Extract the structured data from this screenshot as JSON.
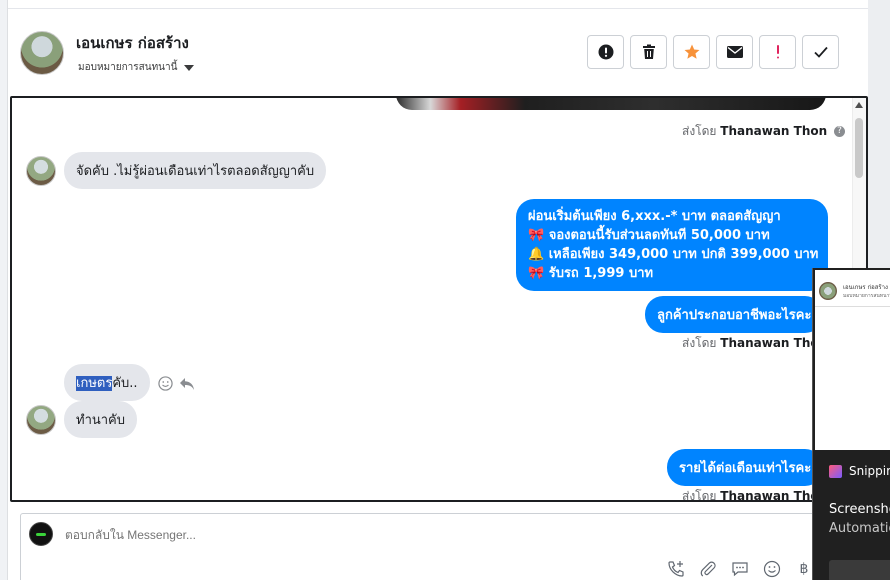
{
  "header": {
    "page_name": "เอนเกษร ก่อสร้าง",
    "assign_label": "มอบหมายการสนทนานี้",
    "actions": [
      {
        "name": "alert-circle-icon",
        "label": "!"
      },
      {
        "name": "trash-icon",
        "label": ""
      },
      {
        "name": "star-icon",
        "label": ""
      },
      {
        "name": "envelope-icon",
        "label": ""
      },
      {
        "name": "exclamation-icon",
        "label": "!"
      },
      {
        "name": "check-icon",
        "label": ""
      }
    ]
  },
  "chat": {
    "sent_by_prefix": "ส่งโดย",
    "sent_by_name": "Thanawan Thon",
    "messages": {
      "incoming_1": "จัดคับ .ไม่รู้ผ่อนเดือนเท่าไรตลอดสัญญาคับ",
      "outgoing_1_lines": [
        "ผ่อนเริ่มต้นเพียง 6,xxx.-* บาท ตลอดสัญญา",
        "🎀 จองตอนนี้รับส่วนลดทันที 50,000 บาท",
        "🔔 เหลือเพียง 349,000 บาท ปกติ  399,000 บาท",
        "🎀 รับรถ 1,999 บาท"
      ],
      "outgoing_2": "ลูกค้าประกอบอาชีพอะไรคะ",
      "incoming_2_highlight": "เกษตร",
      "incoming_2_rest": "คับ..",
      "incoming_3": "ทำนาคับ",
      "outgoing_3": "รายได้ต่อเดือนเท่าไรคะ"
    }
  },
  "composer": {
    "placeholder": "ตอบกลับใน Messenger..."
  },
  "overlay": {
    "mini_title": "เอนเกษร ก่อสร้าง",
    "mini_sub": "มอบหมายการสนทนานี้ ▾",
    "app_name": "Snippir",
    "title": "Screensho",
    "subtitle": "Automatio"
  },
  "colors": {
    "messenger_blue": "#0084ff",
    "incoming_gray": "#e4e6eb",
    "star_orange": "#f7923a",
    "exclaim_red": "#e0245e"
  }
}
